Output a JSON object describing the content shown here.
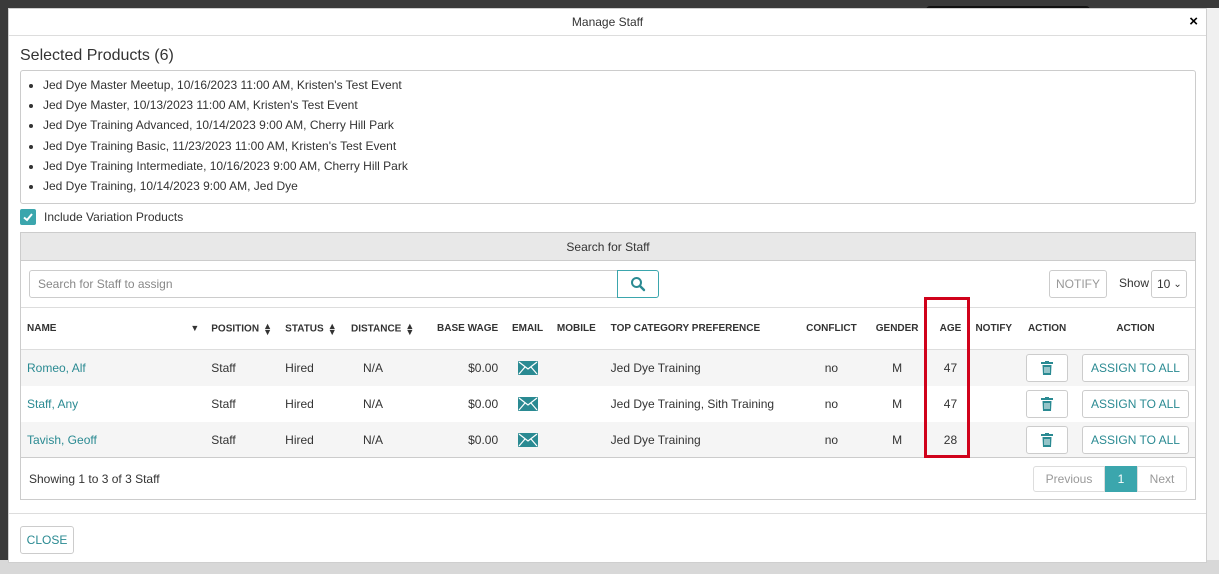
{
  "modal": {
    "title": "Manage Staff",
    "close_glyph": "×"
  },
  "selected_products": {
    "title": "Selected Products (6)",
    "items": [
      "Jed Dye Master Meetup, 10/16/2023 11:00 AM, Kristen's Test Event",
      "Jed Dye Master, 10/13/2023 11:00 AM, Kristen's Test Event",
      "Jed Dye Training Advanced, 10/14/2023 9:00 AM, Cherry Hill Park",
      "Jed Dye Training Basic, 11/23/2023 11:00 AM, Kristen's Test Event",
      "Jed Dye Training Intermediate, 10/16/2023 9:00 AM, Cherry Hill Park",
      "Jed Dye Training, 10/14/2023 9:00 AM, Jed Dye"
    ]
  },
  "include_variation": {
    "label": "Include Variation Products",
    "checked": true
  },
  "search": {
    "panel_title": "Search for Staff",
    "placeholder": "Search for Staff to assign",
    "notify_label": "NOTIFY",
    "show_label": "Show",
    "show_value": "10"
  },
  "table": {
    "headers": {
      "name": "NAME",
      "position": "POSITION",
      "status": "STATUS",
      "distance": "DISTANCE",
      "base_wage": "BASE WAGE",
      "email": "EMAIL",
      "mobile": "MOBILE",
      "top_category": "TOP CATEGORY PREFERENCE",
      "conflict": "CONFLICT",
      "gender": "GENDER",
      "age": "AGE",
      "notify": "NOTIFY",
      "action1": "ACTION",
      "action2": "ACTION"
    },
    "assign_label": "ASSIGN TO ALL",
    "rows": [
      {
        "name": "Romeo, Alf",
        "position": "Staff",
        "status": "Hired",
        "distance": "N/A",
        "base_wage": "$0.00",
        "mobile": "",
        "top_category": "Jed Dye Training",
        "conflict": "no",
        "gender": "M",
        "age": "47",
        "notify": ""
      },
      {
        "name": "Staff, Any",
        "position": "Staff",
        "status": "Hired",
        "distance": "N/A",
        "base_wage": "$0.00",
        "mobile": "",
        "top_category": "Jed Dye Training, Sith Training",
        "conflict": "no",
        "gender": "M",
        "age": "47",
        "notify": ""
      },
      {
        "name": "Tavish, Geoff",
        "position": "Staff",
        "status": "Hired",
        "distance": "N/A",
        "base_wage": "$0.00",
        "mobile": "",
        "top_category": "Jed Dye Training",
        "conflict": "no",
        "gender": "M",
        "age": "28",
        "notify": ""
      }
    ]
  },
  "footer": {
    "showing": "Showing 1 to 3 of 3 Staff",
    "prev": "Previous",
    "page": "1",
    "next": "Next",
    "close_label": "CLOSE"
  },
  "colors": {
    "accent": "#3ba6ad",
    "link": "#2a8a92",
    "highlight": "#d0021b"
  }
}
